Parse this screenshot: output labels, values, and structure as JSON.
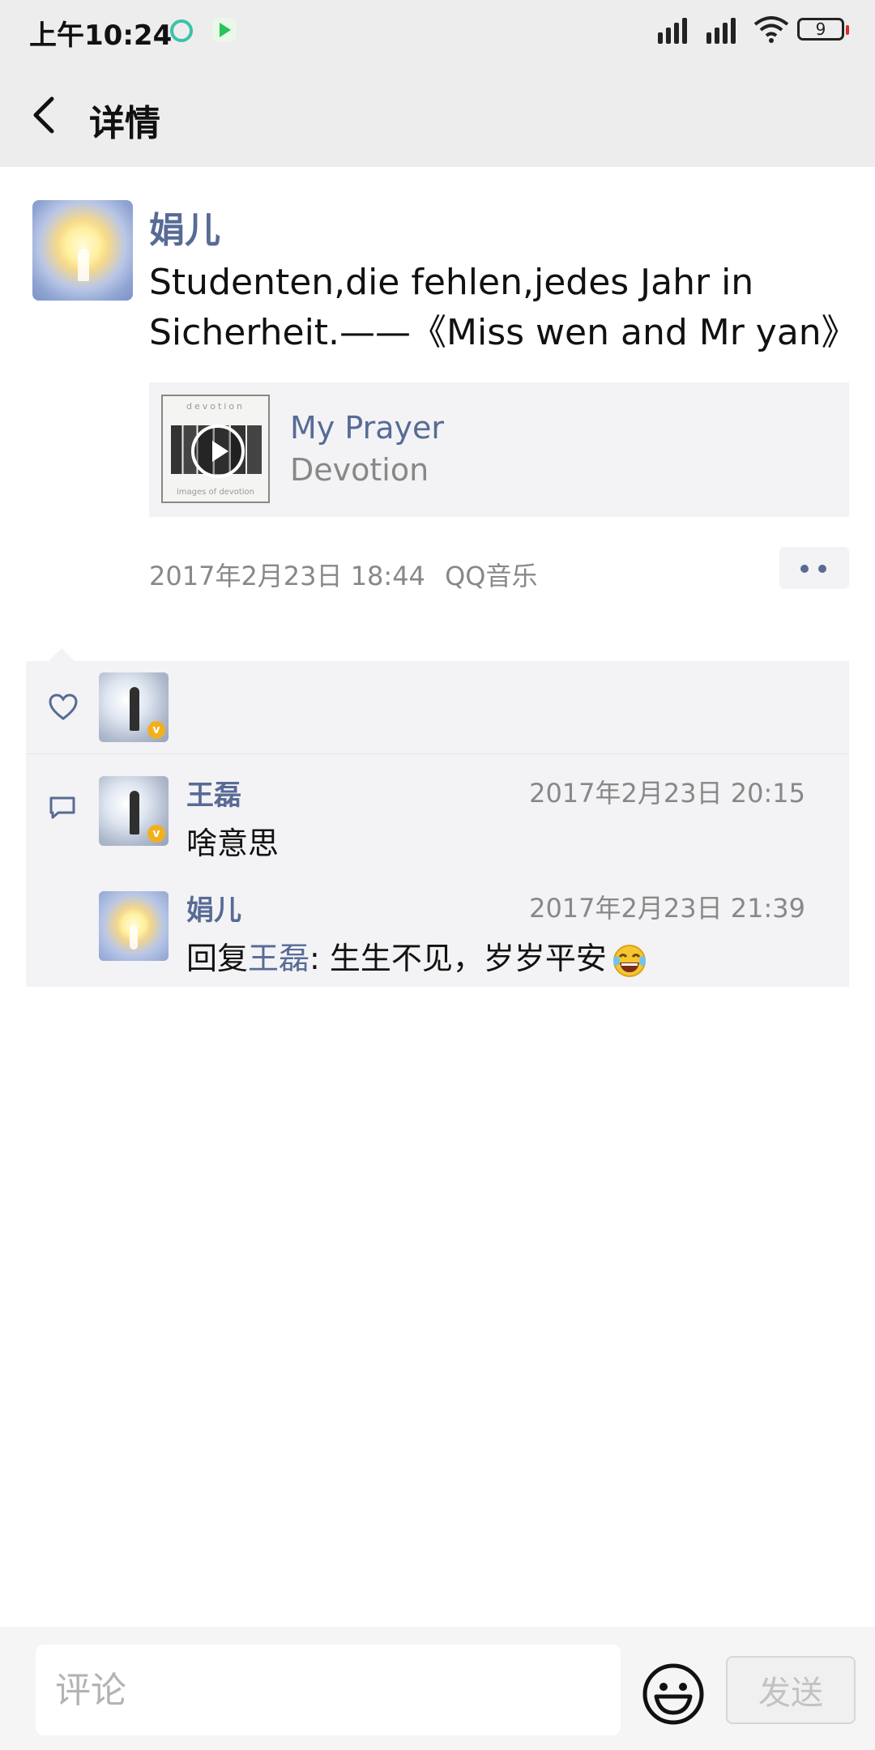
{
  "status_bar": {
    "time": "上午10:24",
    "battery": "9"
  },
  "header": {
    "title": "详情"
  },
  "post": {
    "author": "娟儿",
    "text": "Studenten,die fehlen,jedes Jahr in Sicherheit.——《Miss wen and Mr yan》",
    "music": {
      "title": "My Prayer",
      "artist": "Devotion",
      "cover_caption_top": "devotion",
      "cover_caption_bottom": "images of devotion"
    },
    "time": "2017年2月23日 18:44",
    "source": "QQ音乐"
  },
  "comments": [
    {
      "author": "王磊",
      "time": "2017年2月23日 20:15",
      "text": "啥意思"
    },
    {
      "author": "娟儿",
      "time": "2017年2月23日 21:39",
      "reply_prefix": "回复",
      "reply_to": "王磊",
      "text": ": 生生不见，岁岁平安"
    }
  ],
  "bottom_bar": {
    "placeholder": "评论",
    "send_label": "发送"
  },
  "colors": {
    "link": "#576b95",
    "panel_bg": "#f3f3f5",
    "header_bg": "#ededed"
  }
}
